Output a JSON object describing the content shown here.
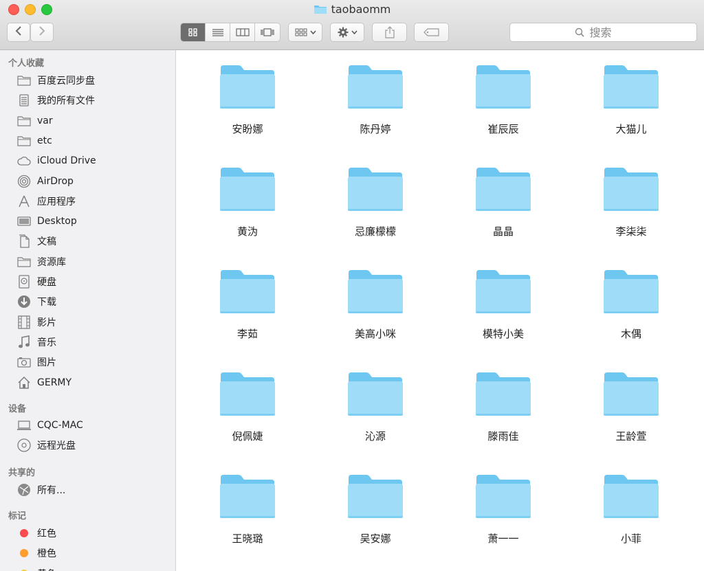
{
  "window": {
    "title": "taobaomm"
  },
  "toolbar": {
    "back_icon": "chevron-left-icon",
    "forward_icon": "chevron-right-icon",
    "views": [
      "icon-view-icon",
      "list-view-icon",
      "column-view-icon",
      "coverflow-view-icon"
    ],
    "arrange_icon": "arrange-grid-icon",
    "action_icon": "gear-icon",
    "share_icon": "share-icon",
    "tag_icon": "tag-icon"
  },
  "search": {
    "placeholder": "搜索"
  },
  "sidebar": {
    "favorites_header": "个人收藏",
    "favorites": [
      {
        "label": "百度云同步盘",
        "icon": "folder-icon"
      },
      {
        "label": "我的所有文件",
        "icon": "all-files-icon"
      },
      {
        "label": "var",
        "icon": "folder-icon"
      },
      {
        "label": "etc",
        "icon": "folder-icon"
      },
      {
        "label": "iCloud Drive",
        "icon": "cloud-icon"
      },
      {
        "label": "AirDrop",
        "icon": "airdrop-icon"
      },
      {
        "label": "应用程序",
        "icon": "applications-icon"
      },
      {
        "label": "Desktop",
        "icon": "desktop-icon"
      },
      {
        "label": "文稿",
        "icon": "documents-icon"
      },
      {
        "label": "资源库",
        "icon": "folder-icon"
      },
      {
        "label": "硬盘",
        "icon": "disk-icon"
      },
      {
        "label": "下载",
        "icon": "download-icon"
      },
      {
        "label": "影片",
        "icon": "movies-icon"
      },
      {
        "label": "音乐",
        "icon": "music-icon"
      },
      {
        "label": "图片",
        "icon": "camera-icon"
      },
      {
        "label": "GERMY",
        "icon": "home-icon"
      }
    ],
    "devices_header": "设备",
    "devices": [
      {
        "label": "CQC-MAC",
        "icon": "laptop-icon"
      },
      {
        "label": "远程光盘",
        "icon": "disc-icon"
      }
    ],
    "shared_header": "共享的",
    "shared": [
      {
        "label": "所有...",
        "icon": "network-icon"
      }
    ],
    "tags_header": "标记",
    "tags": [
      {
        "label": "红色",
        "color": "#fc4b4c"
      },
      {
        "label": "橙色",
        "color": "#fd9e2f"
      },
      {
        "label": "黄色",
        "color": "#f7cf2f"
      }
    ]
  },
  "folders": [
    "安盼娜",
    "陈丹婷",
    "崔辰辰",
    "大猫儿",
    "黄沩",
    "忌廉檬檬",
    "晶晶",
    "李柒柒",
    "李茹",
    "美高小咪",
    "模特小美",
    "木偶",
    "倪佩婕",
    "沁源",
    "滕雨佳",
    "王龄萱",
    "王晓璐",
    "吴安娜",
    "萧一一",
    "小菲"
  ],
  "colors": {
    "folder_light": "#9fdcf8",
    "folder_dark": "#6ec7f1",
    "active_view": "#6d6d6d"
  }
}
